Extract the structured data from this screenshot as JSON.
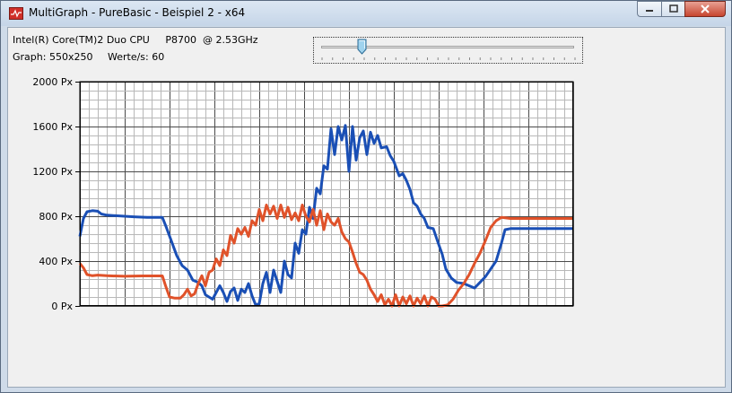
{
  "window": {
    "title": "MultiGraph - PureBasic - Beispiel 2 - x64"
  },
  "info": {
    "cpu": "Intel(R) Core(TM)2 Duo CPU     P8700  @ 2.53GHz",
    "graph_size": "Graph: 550x250",
    "rate": "Werte/s: 60"
  },
  "slider": {
    "value_fraction": 0.16
  },
  "colors": {
    "series_blue": "#1a4fb5",
    "series_red": "#e0522a",
    "grid_minor": "#b8b8b8",
    "grid_major": "#4a4a4a"
  },
  "chart_data": {
    "type": "line",
    "ylim": [
      0,
      2000
    ],
    "y_tick_labels": [
      "0 Px",
      "400 Px",
      "800 Px",
      "1200 Px",
      "1600 Px",
      "2000 Px"
    ],
    "y_tick_values": [
      0,
      400,
      800,
      1200,
      1600,
      2000
    ],
    "xlim": [
      0,
      550
    ],
    "series": [
      {
        "color": "#1a4fb5",
        "points": [
          [
            0,
            620
          ],
          [
            4,
            780
          ],
          [
            8,
            840
          ],
          [
            14,
            850
          ],
          [
            20,
            845
          ],
          [
            24,
            820
          ],
          [
            30,
            810
          ],
          [
            40,
            805
          ],
          [
            50,
            800
          ],
          [
            60,
            795
          ],
          [
            75,
            790
          ],
          [
            92,
            790
          ],
          [
            96,
            710
          ],
          [
            102,
            580
          ],
          [
            108,
            450
          ],
          [
            114,
            360
          ],
          [
            120,
            320
          ],
          [
            126,
            230
          ],
          [
            132,
            210
          ],
          [
            136,
            180
          ],
          [
            140,
            100
          ],
          [
            144,
            80
          ],
          [
            148,
            60
          ],
          [
            152,
            120
          ],
          [
            156,
            180
          ],
          [
            160,
            120
          ],
          [
            164,
            40
          ],
          [
            168,
            130
          ],
          [
            172,
            160
          ],
          [
            176,
            50
          ],
          [
            180,
            150
          ],
          [
            184,
            120
          ],
          [
            188,
            200
          ],
          [
            192,
            90
          ],
          [
            196,
            10
          ],
          [
            200,
            20
          ],
          [
            204,
            200
          ],
          [
            208,
            300
          ],
          [
            212,
            120
          ],
          [
            216,
            320
          ],
          [
            220,
            220
          ],
          [
            224,
            120
          ],
          [
            228,
            400
          ],
          [
            232,
            280
          ],
          [
            236,
            250
          ],
          [
            240,
            560
          ],
          [
            244,
            470
          ],
          [
            248,
            680
          ],
          [
            252,
            640
          ],
          [
            256,
            880
          ],
          [
            260,
            780
          ],
          [
            264,
            1050
          ],
          [
            268,
            1000
          ],
          [
            272,
            1250
          ],
          [
            276,
            1220
          ],
          [
            280,
            1580
          ],
          [
            284,
            1350
          ],
          [
            288,
            1600
          ],
          [
            292,
            1480
          ],
          [
            296,
            1610
          ],
          [
            300,
            1200
          ],
          [
            304,
            1600
          ],
          [
            308,
            1300
          ],
          [
            312,
            1500
          ],
          [
            316,
            1560
          ],
          [
            320,
            1350
          ],
          [
            324,
            1550
          ],
          [
            328,
            1450
          ],
          [
            332,
            1520
          ],
          [
            336,
            1410
          ],
          [
            342,
            1420
          ],
          [
            346,
            1340
          ],
          [
            350,
            1290
          ],
          [
            356,
            1160
          ],
          [
            360,
            1180
          ],
          [
            364,
            1120
          ],
          [
            368,
            1040
          ],
          [
            372,
            920
          ],
          [
            376,
            890
          ],
          [
            380,
            820
          ],
          [
            384,
            780
          ],
          [
            388,
            700
          ],
          [
            394,
            690
          ],
          [
            400,
            550
          ],
          [
            404,
            460
          ],
          [
            408,
            330
          ],
          [
            414,
            250
          ],
          [
            420,
            210
          ],
          [
            428,
            200
          ],
          [
            434,
            180
          ],
          [
            440,
            160
          ],
          [
            446,
            210
          ],
          [
            452,
            260
          ],
          [
            458,
            330
          ],
          [
            464,
            400
          ],
          [
            470,
            560
          ],
          [
            474,
            680
          ],
          [
            480,
            690
          ],
          [
            500,
            690
          ],
          [
            550,
            690
          ]
        ]
      },
      {
        "color": "#e0522a",
        "points": [
          [
            0,
            380
          ],
          [
            4,
            340
          ],
          [
            8,
            280
          ],
          [
            14,
            270
          ],
          [
            20,
            275
          ],
          [
            30,
            270
          ],
          [
            50,
            265
          ],
          [
            70,
            268
          ],
          [
            92,
            268
          ],
          [
            96,
            170
          ],
          [
            100,
            80
          ],
          [
            106,
            70
          ],
          [
            112,
            70
          ],
          [
            116,
            100
          ],
          [
            120,
            150
          ],
          [
            124,
            90
          ],
          [
            128,
            110
          ],
          [
            132,
            200
          ],
          [
            136,
            270
          ],
          [
            140,
            180
          ],
          [
            144,
            300
          ],
          [
            148,
            320
          ],
          [
            152,
            420
          ],
          [
            156,
            360
          ],
          [
            160,
            500
          ],
          [
            164,
            450
          ],
          [
            168,
            630
          ],
          [
            172,
            560
          ],
          [
            176,
            690
          ],
          [
            180,
            640
          ],
          [
            184,
            700
          ],
          [
            188,
            620
          ],
          [
            192,
            760
          ],
          [
            196,
            720
          ],
          [
            200,
            860
          ],
          [
            204,
            760
          ],
          [
            208,
            900
          ],
          [
            212,
            820
          ],
          [
            216,
            890
          ],
          [
            220,
            780
          ],
          [
            224,
            900
          ],
          [
            228,
            790
          ],
          [
            232,
            880
          ],
          [
            236,
            770
          ],
          [
            240,
            830
          ],
          [
            244,
            760
          ],
          [
            248,
            900
          ],
          [
            252,
            800
          ],
          [
            256,
            750
          ],
          [
            260,
            860
          ],
          [
            264,
            720
          ],
          [
            268,
            850
          ],
          [
            272,
            680
          ],
          [
            276,
            820
          ],
          [
            280,
            750
          ],
          [
            284,
            720
          ],
          [
            288,
            780
          ],
          [
            292,
            660
          ],
          [
            296,
            600
          ],
          [
            300,
            570
          ],
          [
            304,
            480
          ],
          [
            308,
            380
          ],
          [
            312,
            300
          ],
          [
            316,
            280
          ],
          [
            320,
            230
          ],
          [
            324,
            150
          ],
          [
            328,
            100
          ],
          [
            332,
            40
          ],
          [
            336,
            100
          ],
          [
            340,
            10
          ],
          [
            344,
            60
          ],
          [
            348,
            0
          ],
          [
            352,
            100
          ],
          [
            356,
            0
          ],
          [
            360,
            80
          ],
          [
            364,
            20
          ],
          [
            368,
            90
          ],
          [
            372,
            0
          ],
          [
            376,
            70
          ],
          [
            380,
            20
          ],
          [
            384,
            90
          ],
          [
            388,
            0
          ],
          [
            392,
            80
          ],
          [
            396,
            60
          ],
          [
            400,
            0
          ],
          [
            404,
            0
          ],
          [
            410,
            10
          ],
          [
            416,
            60
          ],
          [
            422,
            140
          ],
          [
            428,
            200
          ],
          [
            434,
            280
          ],
          [
            440,
            380
          ],
          [
            446,
            470
          ],
          [
            452,
            580
          ],
          [
            458,
            700
          ],
          [
            464,
            760
          ],
          [
            470,
            790
          ],
          [
            480,
            780
          ],
          [
            500,
            780
          ],
          [
            550,
            780
          ]
        ]
      }
    ]
  }
}
